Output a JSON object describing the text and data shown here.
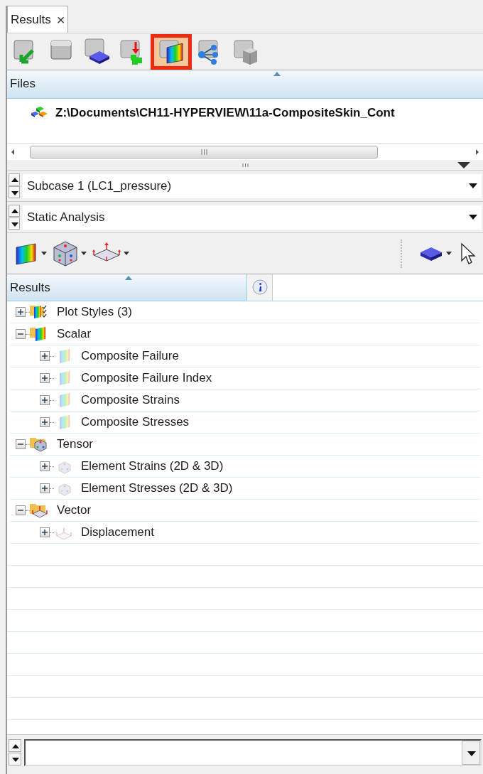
{
  "tab": {
    "label": "Results",
    "close": "×",
    "selected": true
  },
  "toolbar": [
    {
      "kind": "load",
      "selected": false
    },
    {
      "kind": "folder",
      "selected": false
    },
    {
      "kind": "model",
      "selected": false
    },
    {
      "kind": "import",
      "selected": false
    },
    {
      "kind": "contour",
      "selected": true
    },
    {
      "kind": "tree",
      "selected": false
    },
    {
      "kind": "box",
      "selected": false
    }
  ],
  "files": {
    "header": "Files",
    "rows": [
      {
        "path": "Z:\\Documents\\CH11-HYPERVIEW\\11a-CompositeSkin_Cont"
      }
    ]
  },
  "subcase": {
    "value": "Subcase 1 (LC1_pressure)"
  },
  "analysis": {
    "value": "Static Analysis"
  },
  "results": {
    "header": "Results",
    "tree": [
      {
        "kind": "plot-styles",
        "label": "Plot Styles (3)",
        "expanded": false
      },
      {
        "kind": "scalar",
        "label": "Scalar",
        "expanded": true,
        "children": [
          {
            "kind": "scalar",
            "label": "Composite Failure",
            "expanded": false
          },
          {
            "kind": "scalar",
            "label": "Composite Failure Index",
            "expanded": false
          },
          {
            "kind": "scalar",
            "label": "Composite Strains",
            "expanded": false
          },
          {
            "kind": "scalar",
            "label": "Composite Stresses",
            "expanded": false
          }
        ]
      },
      {
        "kind": "tensor",
        "label": "Tensor",
        "expanded": true,
        "children": [
          {
            "kind": "tensor",
            "label": "Element Strains (2D & 3D)",
            "expanded": false
          },
          {
            "kind": "tensor",
            "label": "Element Stresses (2D & 3D)",
            "expanded": false
          }
        ]
      },
      {
        "kind": "vector",
        "label": "Vector",
        "expanded": true,
        "children": [
          {
            "kind": "vector",
            "label": "Displacement",
            "expanded": false
          }
        ]
      }
    ]
  }
}
